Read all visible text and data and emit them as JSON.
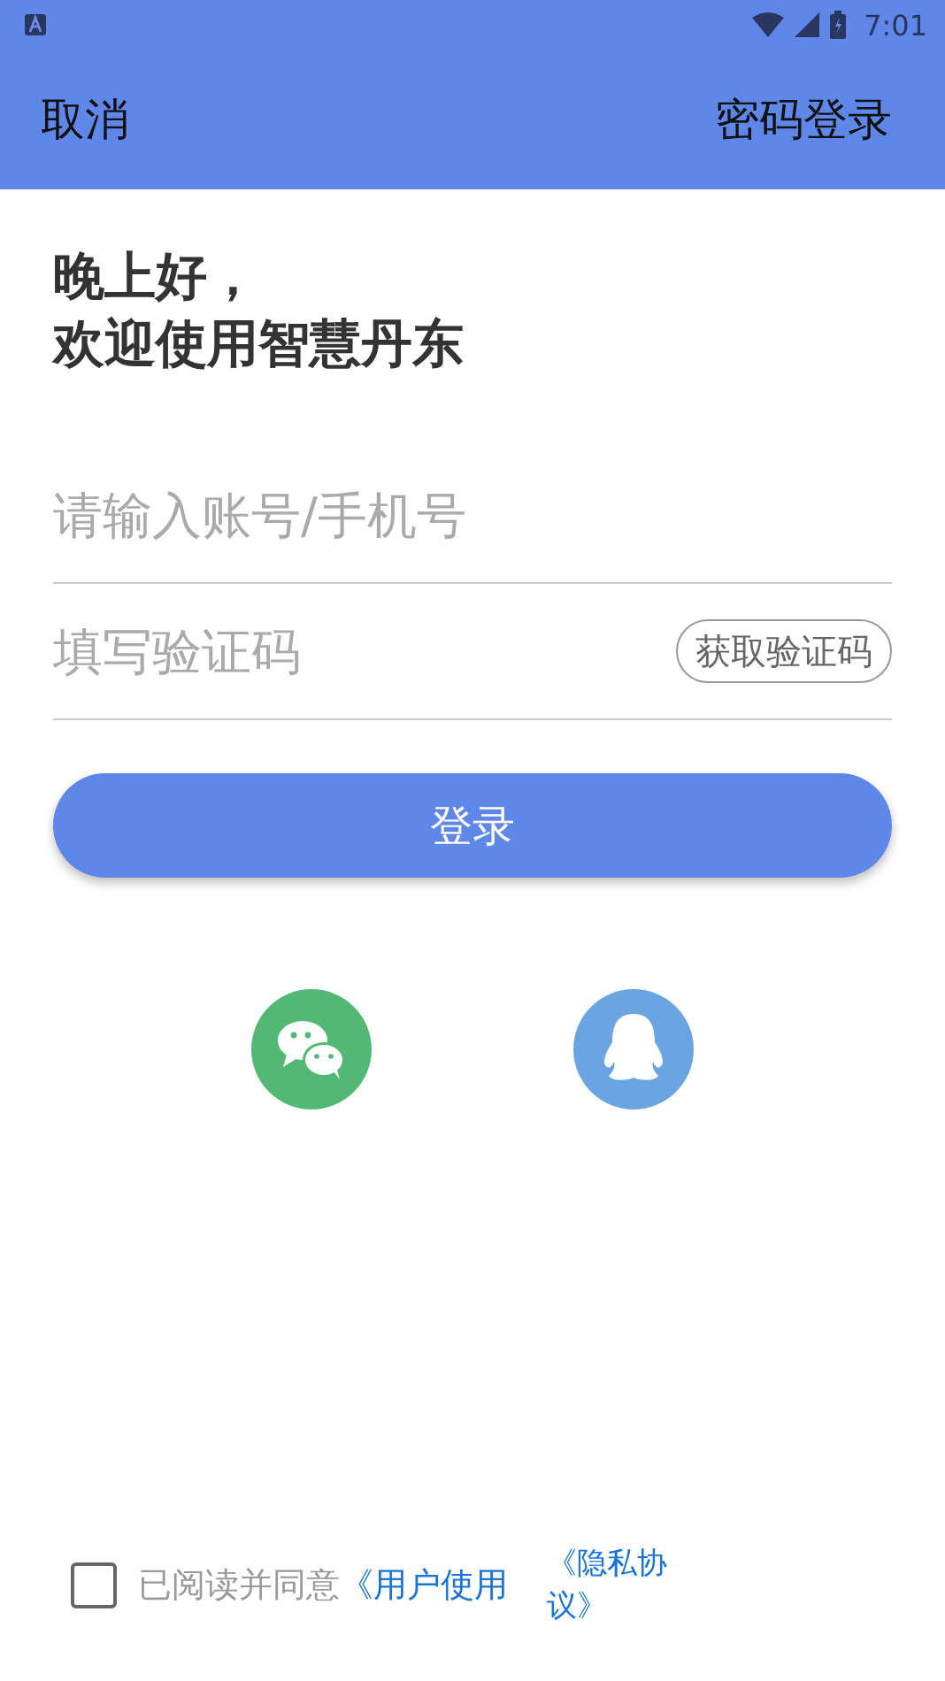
{
  "status_bar": {
    "time": "7:01"
  },
  "header": {
    "left": "取消",
    "right": "密码登录"
  },
  "greeting": {
    "line1": "晚上好，",
    "line2": "欢迎使用智慧丹东"
  },
  "account_field": {
    "placeholder": "请输入账号/手机号"
  },
  "code_field": {
    "placeholder": "填写验证码",
    "button": "获取验证码"
  },
  "login_button": "登录",
  "social": [
    {
      "kind": "wechat"
    },
    {
      "kind": "qq"
    }
  ],
  "agreement": {
    "checked": false,
    "text": "已阅读并同意",
    "links": [
      "《用户使用"
    ],
    "second_link": [
      "《隐私协",
      "议》"
    ]
  }
}
